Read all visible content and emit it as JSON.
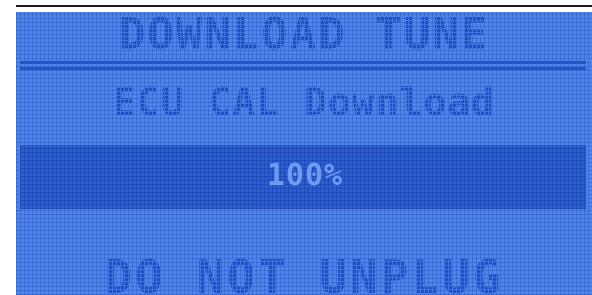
{
  "screen": {
    "title": "DOWNLOAD TUNE",
    "subtitle": "ECU CAL Download",
    "progress_text": "100%",
    "progress": 1.0,
    "warning": "DO NOT UNPLUG"
  },
  "colors": {
    "lcd_background": "#4f86ea",
    "text": "#1e4fc6",
    "progress_band": "#2a5fd2",
    "progress_text": "#6d9bf2"
  }
}
